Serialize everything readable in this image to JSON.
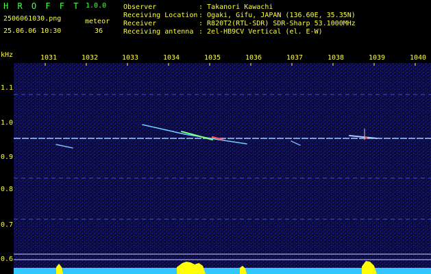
{
  "header": {
    "app_title": "H R O F F T",
    "version": "1.0.0",
    "filename": "2506061030.png",
    "datetime": "25.06.06 10:30",
    "counter_label": "meteor",
    "counter_value": "36",
    "info_labels": [
      "Observer",
      "Receiving Location",
      "Receiver",
      "Receiving antenna"
    ],
    "info_values": [
      ": Takanori Kawachi",
      ": Ogaki, Gifu, JAPAN (136.60E, 35.35N)",
      ": R820T2(RTL-SDR) SDR-Sharp 53.1000MHz",
      ": 2el-HB9CV Vertical (el. E-W)"
    ]
  },
  "x_axis": {
    "ticks": [
      "1031",
      "1032",
      "1033",
      "1034",
      "1035",
      "1036",
      "1037",
      "1038",
      "1039",
      "1040"
    ]
  },
  "y_axis": {
    "unit": "kHz",
    "ticks": [
      "1.1",
      "1.0",
      "0.9",
      "0.8",
      "0.7",
      "0.6"
    ]
  },
  "colors": {
    "text_yellow": "#ffff3c",
    "text_green": "#4cff4c",
    "background": "#000000",
    "spectrogram_bg": "#0a0a3c",
    "carrier_line": "#9fd0ff",
    "baseline_cyan": "#30c8ff",
    "peaks_yellow": "#ffff00"
  }
}
